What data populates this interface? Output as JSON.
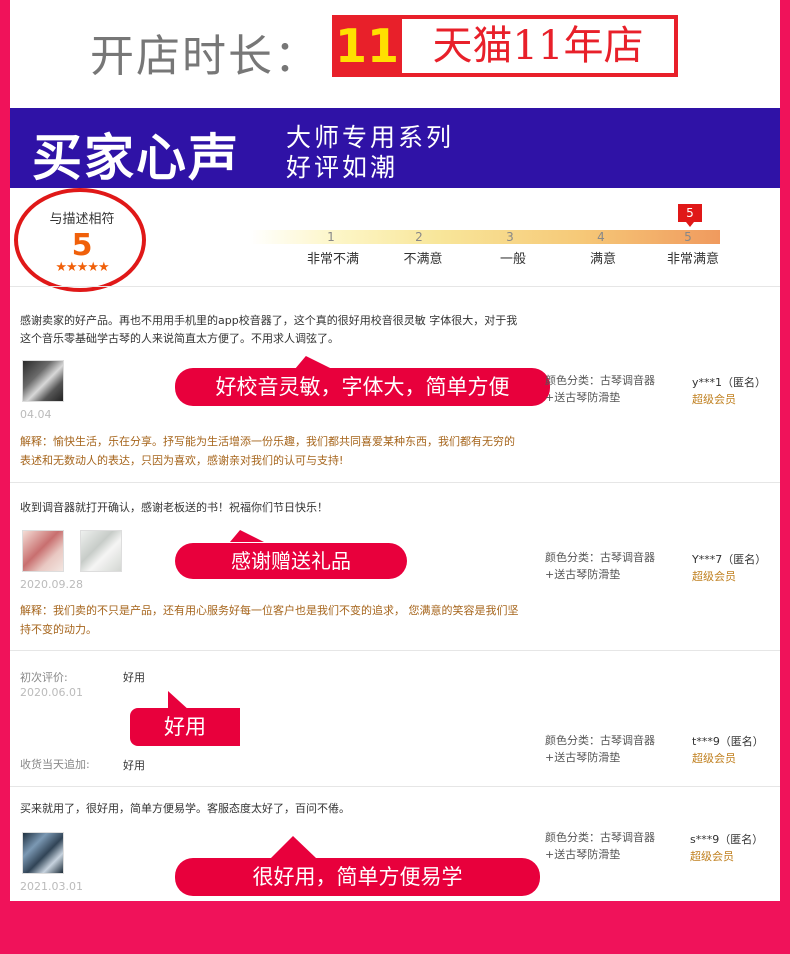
{
  "header": {
    "label": "开店时长：",
    "years": "11",
    "shop_text": "天猫11年店"
  },
  "banner": {
    "title": "买家心声",
    "sub1": "大师专用系列",
    "sub2": "好评如潮"
  },
  "rating": {
    "label": "与描述相符",
    "score": "5",
    "stars": "★★★★★",
    "selected": "5",
    "scale": [
      {
        "num": "1",
        "label": "非常不满"
      },
      {
        "num": "2",
        "label": "不满意"
      },
      {
        "num": "3",
        "label": "一般"
      },
      {
        "num": "4",
        "label": "满意"
      },
      {
        "num": "5",
        "label": "非常满意"
      }
    ]
  },
  "reviews": [
    {
      "text": "感谢卖家的好产品。再也不用用手机里的app校音器了，这个真的很好用校音很灵敏 字体很大，对于我这个音乐零基础学古琴的人来说简直太方便了。不用求人调弦了。",
      "date": "04.04",
      "bubble": "好校音灵敏，字体大，简单方便",
      "reply": "解释：愉快生活，乐在分享。抒写能为生活增添一份乐趣，我们都共同喜爱某种东西，我们都有无穷的表述和无数动人的表达，只因为喜欢，感谢亲对我们的认可与支持!",
      "sku1": "颜色分类：古琴调音器",
      "sku2": "+送古琴防滑垫",
      "user": "y***1（匿名）",
      "member": "超级会员"
    },
    {
      "text": "收到调音器就打开确认，感谢老板送的书！祝福你们节日快乐！",
      "date": "2020.09.28",
      "bubble": "感谢赠送礼品",
      "reply": "解释：我们卖的不只是产品，还有用心服务好每一位客户也是我们不变的追求， 您满意的笑容是我们坚持不变的动力。",
      "sku1": "颜色分类：古琴调音器",
      "sku2": "+送古琴防滑垫",
      "user": "Y***7（匿名）",
      "member": "超级会员"
    },
    {
      "first_label": "初次评价:",
      "first_val": "好用",
      "date": "2020.06.01",
      "bubble": "好用",
      "followup_label": "收货当天追加:",
      "followup_val": "好用",
      "sku1": "颜色分类：古琴调音器",
      "sku2": "+送古琴防滑垫",
      "user": "t***9（匿名）",
      "member": "超级会员"
    },
    {
      "text": "买来就用了，很好用，简单方便易学。客服态度太好了，百问不倦。",
      "date": "2021.03.01",
      "bubble": "很好用，简单方便易学",
      "sku1": "颜色分类：古琴调音器",
      "sku2": "+送古琴防滑垫",
      "user": "s***9（匿名）",
      "member": "超级会员"
    }
  ],
  "colors": {
    "background": "#f0125a",
    "banner": "#2f12a6",
    "badge_red": "#e8202a",
    "badge_yellow": "#ffe000",
    "bubble": "#e8003c",
    "reply": "#a6651c",
    "member": "#c08020"
  }
}
